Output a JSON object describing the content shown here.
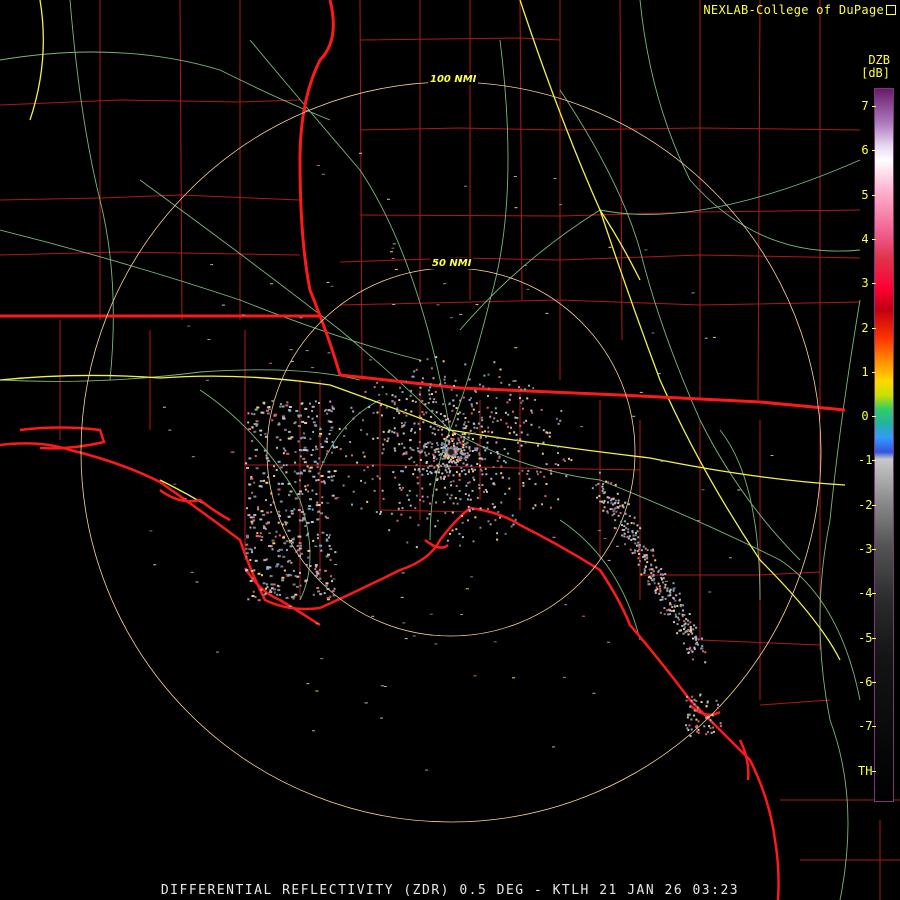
{
  "product": {
    "caption": "DIFFERENTIAL REFLECTIVITY (ZDR) 0.5 DEG - KTLH 21 JAN 26 03:23",
    "credit": "NEXLAB-College of DuPage",
    "credit_icon": "external-link-icon"
  },
  "legend": {
    "code": "DZB",
    "units": "[dB]",
    "labels": [
      "7",
      "6",
      "5",
      "4",
      "3",
      "2",
      "1",
      "0",
      "-1",
      "-2",
      "-3",
      "-4",
      "-5",
      "-6",
      "-7",
      "TH"
    ]
  },
  "range_rings": [
    {
      "label": "50 NMI"
    },
    {
      "label": "100 NMI"
    }
  ],
  "colors": {
    "background": "#000000",
    "county_lines": "#b01818",
    "state_lines": "#ff1a1a",
    "highways": "#8fd88f",
    "interstates": "#f2f24a",
    "range_rings": "#ffd49a",
    "label_text": "#ffff44"
  }
}
